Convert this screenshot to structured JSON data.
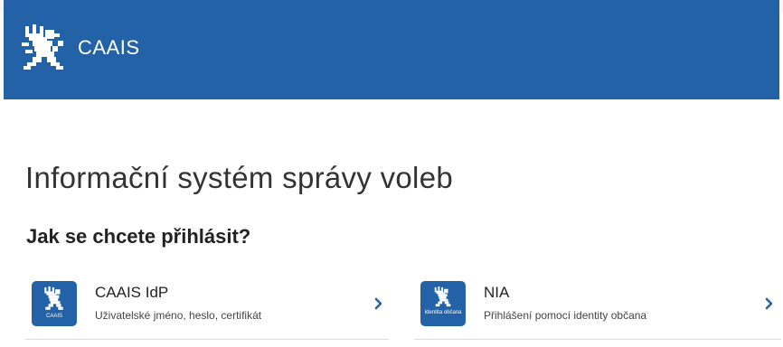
{
  "header": {
    "app_title": "CAAIS",
    "logo_icon": "czech-lion-icon",
    "background": "#2362a6"
  },
  "main": {
    "page_title": "Informační systém správy voleb",
    "subtitle": "Jak se chcete přihlásit?"
  },
  "login_options": [
    {
      "icon": "czech-lion-icon",
      "icon_label": "CAAIS",
      "title": "CAAIS IdP",
      "description": "Uživatelské jméno, heslo, certifikát",
      "arrow_icon": "chevron-right-icon"
    },
    {
      "icon": "czech-lion-icon",
      "icon_label": "Identita občana",
      "title": "NIA",
      "description": "Přihlášení pomocí identity občana",
      "arrow_icon": "chevron-right-icon"
    }
  ],
  "colors": {
    "brand": "#2362a6",
    "text": "#222222",
    "divider": "#dcdcdc"
  }
}
